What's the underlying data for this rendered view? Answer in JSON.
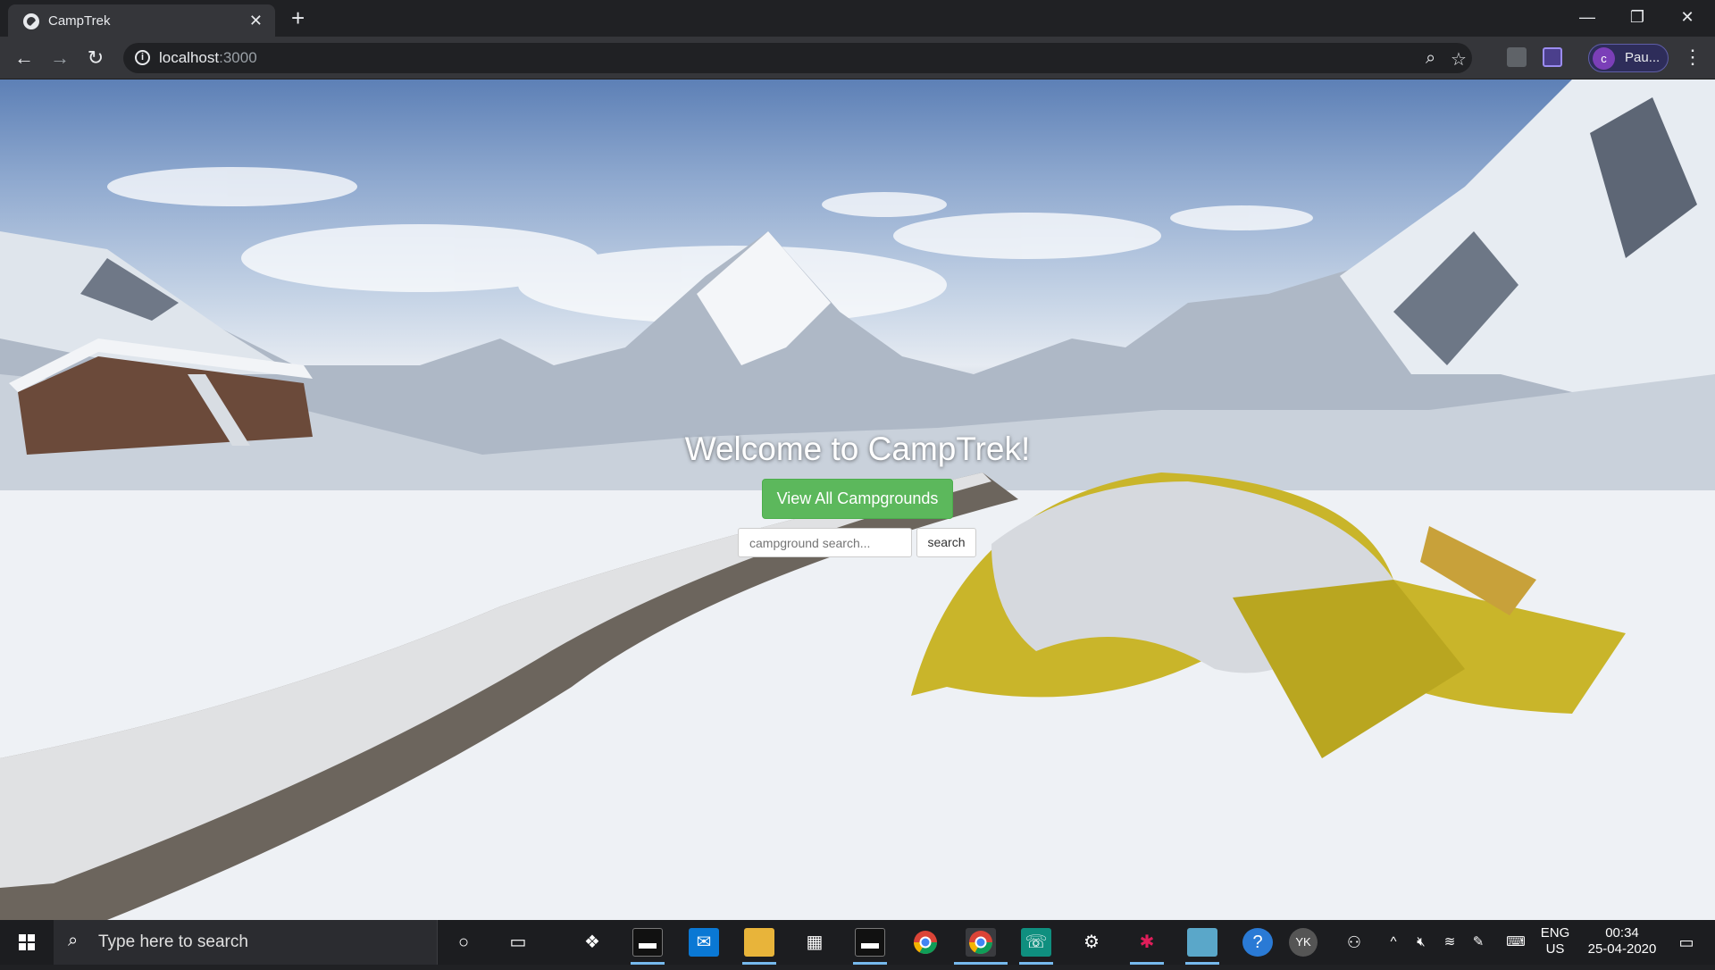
{
  "browser": {
    "tab_title": "CampTrek",
    "new_tab_symbol": "+",
    "close_symbol": "✕",
    "url_host": "localhost",
    "url_port": ":3000",
    "profile_initial": "c",
    "profile_name": "Pau...",
    "window_controls": {
      "minimize": "—",
      "restore": "❐",
      "close": "✕"
    }
  },
  "page": {
    "heading": "Welcome to CampTrek!",
    "cta_label": "View All Campgrounds",
    "search_placeholder": "campground search...",
    "search_button": "search"
  },
  "taskbar": {
    "search_placeholder": "Type here to search",
    "pinned_apps": [
      "cortana-icon",
      "task-view-icon",
      "dropbox-icon",
      "terminal-icon",
      "mail-icon",
      "file-explorer-icon",
      "store-icon",
      "terminal-icon",
      "chrome-icon",
      "chrome-icon",
      "whatsapp-icon",
      "settings-icon",
      "slack-icon",
      "notepad-icon",
      "help-icon"
    ],
    "avatar_initials": "YK",
    "language": "ENG",
    "region": "US",
    "time": "00:34",
    "date": "25-04-2020"
  },
  "colors": {
    "cta_green": "#5cb85c",
    "chrome_dark": "#202124",
    "chrome_toolbar": "#35363a",
    "taskbar": "#1c1d20"
  }
}
